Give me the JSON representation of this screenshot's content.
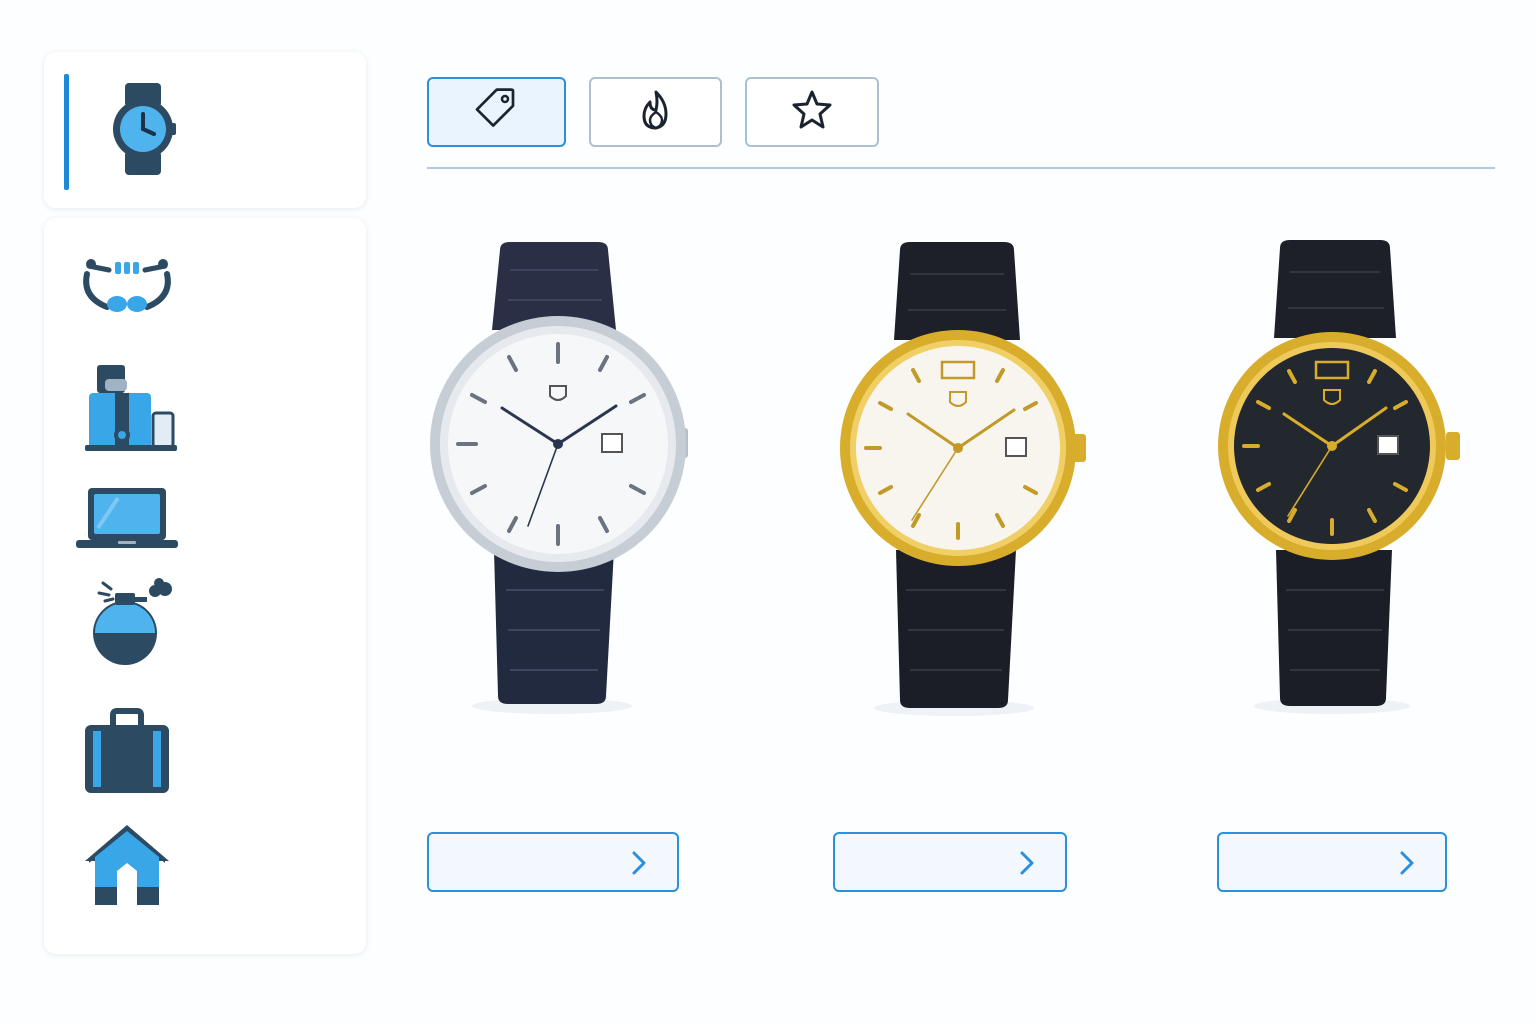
{
  "sidebar": {
    "selected_category": {
      "icon": "wristwatch-icon"
    },
    "categories": [
      {
        "icon": "jewelry-chain-icon"
      },
      {
        "icon": "juicer-appliance-icon"
      },
      {
        "icon": "laptop-icon"
      },
      {
        "icon": "perfume-bottle-icon"
      },
      {
        "icon": "suitcase-icon"
      },
      {
        "icon": "house-icon"
      }
    ]
  },
  "tabs": [
    {
      "icon": "price-tag-icon",
      "active": true
    },
    {
      "icon": "flame-icon",
      "active": false
    },
    {
      "icon": "star-icon",
      "active": false
    }
  ],
  "products": [
    {
      "image": "silver-watch-white-dial-navy-strap",
      "action_icon": "chevron-right-icon"
    },
    {
      "image": "gold-watch-white-dial-black-strap",
      "action_icon": "chevron-right-icon"
    },
    {
      "image": "gold-watch-black-dial-black-strap",
      "action_icon": "chevron-right-icon"
    }
  ],
  "colors": {
    "accent": "#1e88d8",
    "active_tab_bg": "#eaf4fe",
    "icon_navy": "#2d4a63",
    "icon_blue": "#39a6e8",
    "silver": "#c9cfd6",
    "gold": "#d9ad2c"
  }
}
